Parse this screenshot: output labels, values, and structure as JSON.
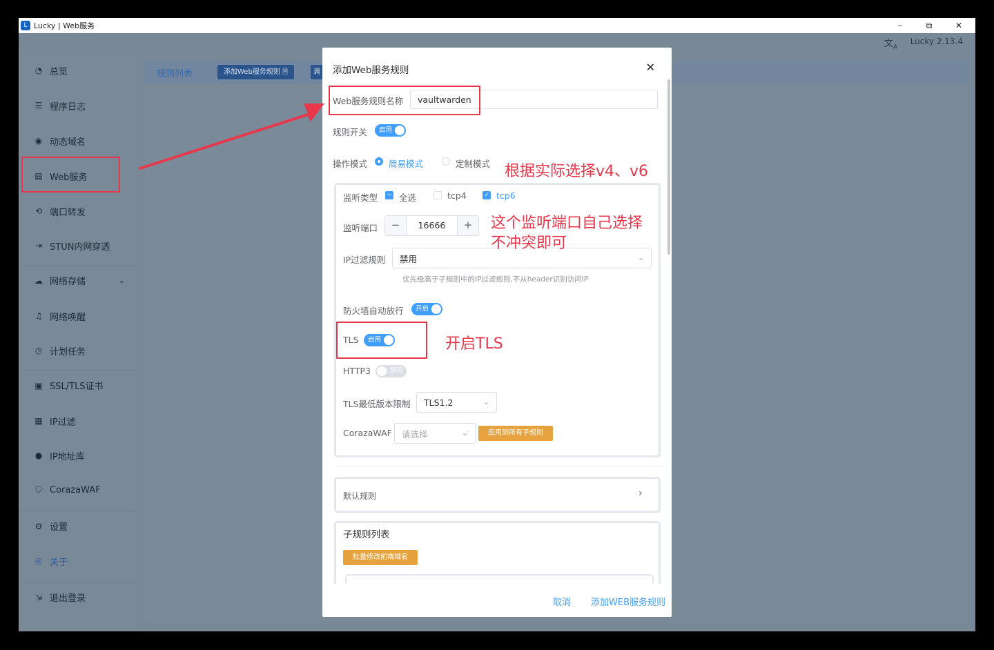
{
  "window": {
    "title": "Lucky | Web服务",
    "app_icon": "app-icon"
  },
  "window_controls": {
    "minimize": "–",
    "restore": "⧉",
    "close": "✕"
  },
  "topbar": {
    "version": "Lucky 2.13.4",
    "lang_icon": "translate-icon"
  },
  "sidebar": {
    "items": [
      {
        "label": "总览",
        "icon": "dashboard-icon"
      },
      {
        "label": "程序日志",
        "icon": "log-icon"
      },
      {
        "label": "动态域名",
        "icon": "ddns-icon"
      },
      {
        "label": "Web服务",
        "icon": "web-icon"
      },
      {
        "label": "端口转发",
        "icon": "port-forward-icon"
      },
      {
        "label": "STUN内网穿透",
        "icon": "stun-icon"
      },
      {
        "label": "网络存储",
        "icon": "cloud-icon"
      },
      {
        "label": "网络唤醒",
        "icon": "bell-icon"
      },
      {
        "label": "计划任务",
        "icon": "clock-icon"
      },
      {
        "label": "SSL/TLS证书",
        "icon": "certificate-icon"
      },
      {
        "label": "IP过滤",
        "icon": "filter-icon"
      },
      {
        "label": "IP地址库",
        "icon": "user-icon"
      },
      {
        "label": "CorazaWAF",
        "icon": "shield-icon"
      },
      {
        "label": "设置",
        "icon": "gear-icon"
      },
      {
        "label": "关于",
        "icon": "fingerprint-icon"
      },
      {
        "label": "退出登录",
        "icon": "logout-icon"
      }
    ]
  },
  "main": {
    "tab_label": "规则列表",
    "add_button": "添加Web服务规则 🗎",
    "second_button": "调"
  },
  "dialog": {
    "title": "添加Web服务规则",
    "close": "✕",
    "name_label": "Web服务规则名称",
    "name_value": "vaultwarden",
    "switch_label": "规则开关",
    "switch_text": "启用",
    "mode_label": "操作模式",
    "mode_simple": "简易模式",
    "mode_custom": "定制模式",
    "listen_type_label": "监听类型",
    "listen_all": "全选",
    "listen_tcp4": "tcp4",
    "listen_tcp6": "tcp6",
    "port_label": "监听端口",
    "port_value": "16666",
    "port_minus": "−",
    "port_plus": "+",
    "ipfilter_label": "IP过滤规则",
    "ipfilter_value": "禁用",
    "ipfilter_hint": "优先级高于子规则中的IP过滤规则,不从header识别访问IP",
    "firewall_label": "防火墙自动放行",
    "firewall_text": "开启",
    "tls_label": "TLS",
    "tls_text": "启用",
    "http3_label": "HTTP3",
    "http3_text": "禁用",
    "tls_min_label": "TLS最低版本限制",
    "tls_min_value": "TLS1.2",
    "waf_label": "CorazaWAF",
    "waf_placeholder": "请选择",
    "waf_apply_button": "应用到所有子规则",
    "default_rule_label": "默认规则",
    "subrules_label": "子规则列表",
    "batch_button": "批量修改前端域名",
    "cancel_button": "取消",
    "submit_button": "添加WEB服务规则"
  },
  "annotations": {
    "note_v4v6": "根据实际选择v4、v6",
    "note_port_line1": "这个监听端口自己选择",
    "note_port_line2": "不冲突即可",
    "note_tls": "开启TLS",
    "color": "#e8364a"
  }
}
